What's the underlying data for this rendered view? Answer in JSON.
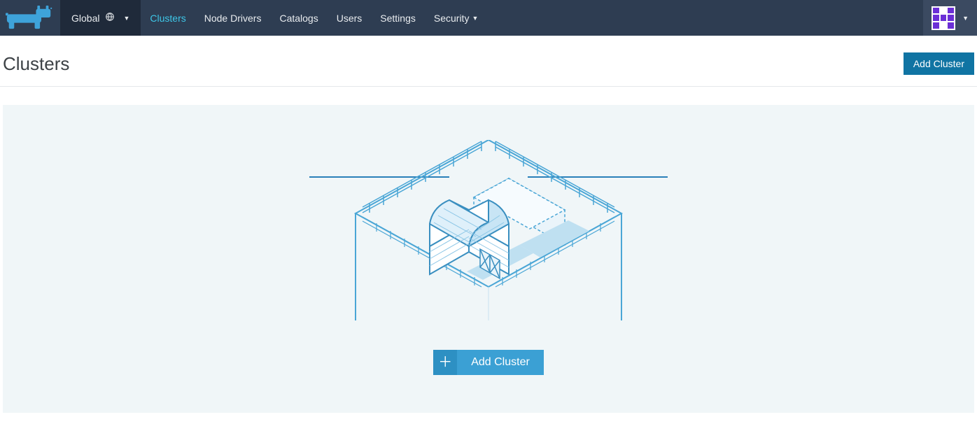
{
  "nav": {
    "context_label": "Global",
    "items": [
      {
        "label": "Clusters",
        "active": true
      },
      {
        "label": "Node Drivers",
        "active": false
      },
      {
        "label": "Catalogs",
        "active": false
      },
      {
        "label": "Users",
        "active": false
      },
      {
        "label": "Settings",
        "active": false
      },
      {
        "label": "Security",
        "active": false,
        "has_caret": true
      }
    ]
  },
  "page": {
    "title": "Clusters",
    "add_cluster_label": "Add Cluster"
  },
  "empty_state": {
    "add_cluster_label": "Add Cluster"
  },
  "colors": {
    "nav_bg": "#2e3d52",
    "nav_dark": "#1f2a3a",
    "accent": "#3ea3da",
    "accent_dark": "#1074a3",
    "empty_bg": "#f0f6f8",
    "avatar": "#6b2fd6"
  }
}
